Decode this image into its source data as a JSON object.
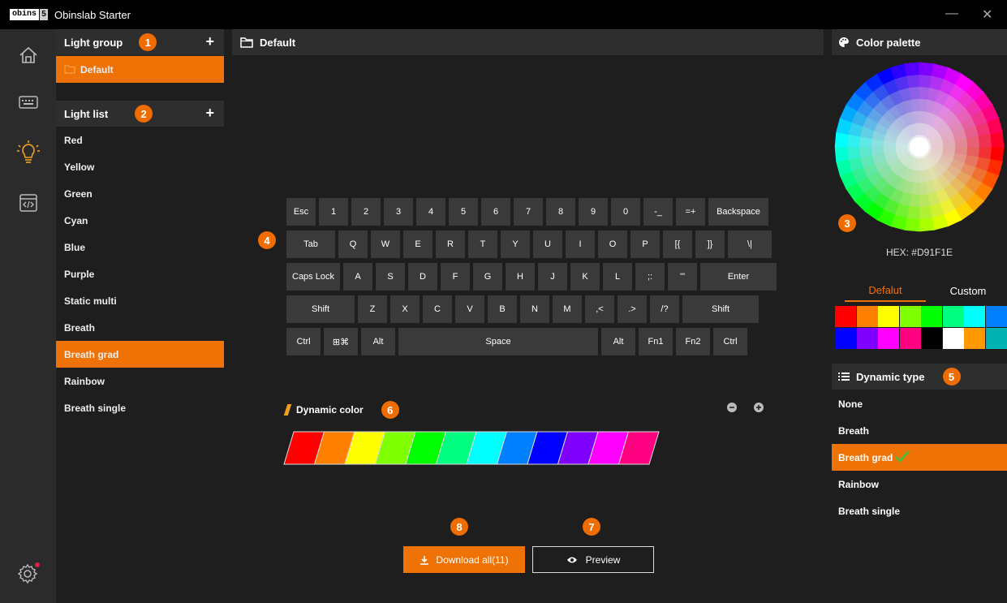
{
  "window": {
    "logo_text": "obins",
    "logo_box2": "5",
    "title": "Obinslab Starter",
    "minimize": "—",
    "close": "✕"
  },
  "light_group": {
    "header": "Light group",
    "badge": "1",
    "add": "+",
    "items": [
      {
        "label": "Default",
        "active": true
      }
    ]
  },
  "light_list": {
    "header": "Light list",
    "badge": "2",
    "add": "+",
    "items": [
      {
        "label": "Red",
        "active": false
      },
      {
        "label": "Yellow",
        "active": false
      },
      {
        "label": "Green",
        "active": false
      },
      {
        "label": "Cyan",
        "active": false
      },
      {
        "label": "Blue",
        "active": false
      },
      {
        "label": "Purple",
        "active": false
      },
      {
        "label": "Static multi",
        "active": false
      },
      {
        "label": "Breath",
        "active": false
      },
      {
        "label": "Breath grad",
        "active": true
      },
      {
        "label": "Rainbow",
        "active": false
      },
      {
        "label": "Breath single",
        "active": false
      }
    ]
  },
  "center": {
    "header": "Default",
    "keyboard_badge": "4",
    "keyboard_rows": [
      [
        "Esc",
        "1",
        "2",
        "3",
        "4",
        "5",
        "6",
        "7",
        "8",
        "9",
        "0",
        "-_",
        "=+",
        "Backspace"
      ],
      [
        "Tab",
        "Q",
        "W",
        "E",
        "R",
        "T",
        "Y",
        "U",
        "I",
        "O",
        "P",
        "[{",
        "]}",
        "\\|"
      ],
      [
        "Caps Lock",
        "A",
        "S",
        "D",
        "F",
        "G",
        "H",
        "J",
        "K",
        "L",
        ";:",
        "'\"",
        "Enter"
      ],
      [
        "Shift",
        "Z",
        "X",
        "C",
        "V",
        "B",
        "N",
        "M",
        ",<",
        ".>",
        "/?",
        "Shift"
      ],
      [
        "Ctrl",
        "⊞⌘",
        "Alt",
        "Space",
        "Alt",
        "Fn1",
        "Fn2",
        "Ctrl"
      ]
    ],
    "dynamic_color": {
      "label": "Dynamic color",
      "badge": "6",
      "colors": [
        "#ff0000",
        "#ff8000",
        "#ffff00",
        "#80ff00",
        "#00ff00",
        "#00ff80",
        "#00ffff",
        "#0080ff",
        "#0000ff",
        "#8000ff",
        "#ff00ff",
        "#ff0080"
      ]
    },
    "download": {
      "label": "Download all(11)",
      "badge": "8"
    },
    "preview": {
      "label": "Preview",
      "badge": "7"
    }
  },
  "palette": {
    "header": "Color palette",
    "badge": "3",
    "hex": "HEX: #D91F1E",
    "tabs": [
      {
        "label": "Defalut",
        "active": true
      },
      {
        "label": "Custom",
        "active": false
      }
    ],
    "swatches": [
      "#ff0000",
      "#ff8000",
      "#ffff00",
      "#80ff00",
      "#00ff00",
      "#00ff80",
      "#00ffff",
      "#0080ff",
      "#0000ff",
      "#8000ff",
      "#ff00ff",
      "#ff0080",
      "#000000",
      "#ffffff",
      "#ff9900",
      "#00b3b3"
    ]
  },
  "dynamic_type": {
    "header": "Dynamic type",
    "badge": "5",
    "items": [
      {
        "label": "None",
        "active": false
      },
      {
        "label": "Breath",
        "active": false
      },
      {
        "label": "Breath grad",
        "active": true
      },
      {
        "label": "Rainbow",
        "active": false
      },
      {
        "label": "Breath single",
        "active": false
      }
    ]
  },
  "accent": "#ef7206"
}
